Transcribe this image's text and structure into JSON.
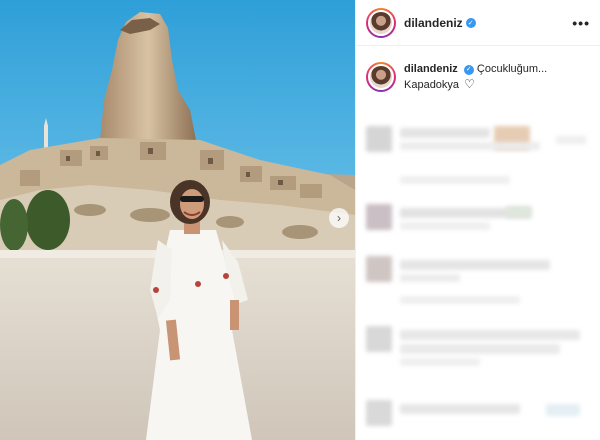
{
  "post": {
    "username": "dilandeniz",
    "verified_icon": "verified-badge-icon",
    "more_label": "•••",
    "caption_username": "dilandeniz",
    "caption_text_line1": "Çocukluğum...",
    "caption_text_line2": "Kapadokya",
    "caption_icon": "heart-outline-icon",
    "next_icon": "chevron-right-icon"
  },
  "colors": {
    "verified": "#3897f0",
    "sky": "#3fa7dc",
    "wall": "#ddd6cb"
  }
}
